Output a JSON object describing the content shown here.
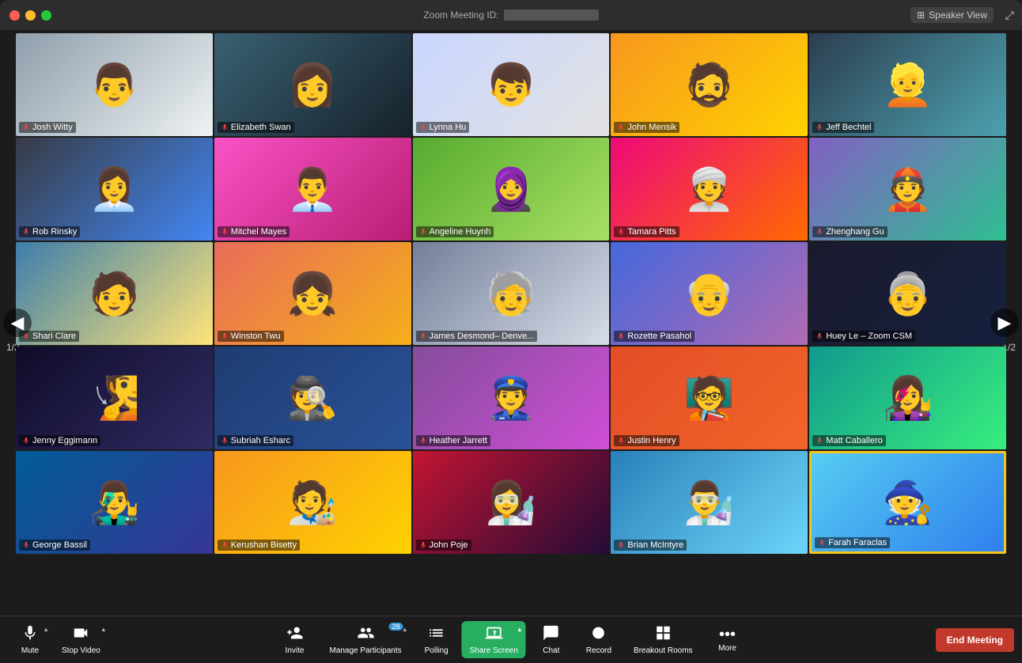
{
  "titleBar": {
    "meetingLabel": "Zoom Meeting ID:",
    "speakerView": "Speaker View"
  },
  "navigation": {
    "leftPage": "1/2",
    "rightPage": "1/2"
  },
  "participants": [
    {
      "id": 1,
      "name": "Josh Witty",
      "colorClass": "c1",
      "muted": false
    },
    {
      "id": 2,
      "name": "Elizabeth Swan",
      "colorClass": "c2",
      "muted": false
    },
    {
      "id": 3,
      "name": "Lynna Hu",
      "colorClass": "c3",
      "muted": false
    },
    {
      "id": 4,
      "name": "John Mensik",
      "colorClass": "c4",
      "muted": false
    },
    {
      "id": 5,
      "name": "Jeff Bechtel",
      "colorClass": "c5",
      "muted": false
    },
    {
      "id": 6,
      "name": "Rob Rinsky",
      "colorClass": "c6",
      "muted": false
    },
    {
      "id": 7,
      "name": "Mitchel Mayes",
      "colorClass": "c7",
      "muted": false
    },
    {
      "id": 8,
      "name": "Angeline Huynh",
      "colorClass": "c8",
      "muted": false
    },
    {
      "id": 9,
      "name": "Tamara Pitts",
      "colorClass": "c9",
      "muted": false
    },
    {
      "id": 10,
      "name": "Zhenghang Gu",
      "colorClass": "c10",
      "muted": false
    },
    {
      "id": 11,
      "name": "Shari Clare",
      "colorClass": "c11",
      "muted": false
    },
    {
      "id": 12,
      "name": "Winston Twu",
      "colorClass": "c12",
      "muted": false
    },
    {
      "id": 13,
      "name": "James Desmond– Denve...",
      "colorClass": "c13",
      "muted": false
    },
    {
      "id": 14,
      "name": "Rozette Pasahol",
      "colorClass": "c14",
      "muted": false
    },
    {
      "id": 15,
      "name": "Huey Le – Zoom CSM",
      "colorClass": "c15",
      "muted": false
    },
    {
      "id": 16,
      "name": "Jenny Eggimann",
      "colorClass": "c16",
      "muted": false
    },
    {
      "id": 17,
      "name": "Subriah Esharc",
      "colorClass": "c17",
      "muted": false
    },
    {
      "id": 18,
      "name": "Heather Jarrett",
      "colorClass": "c18",
      "muted": false
    },
    {
      "id": 19,
      "name": "Justin Henry",
      "colorClass": "c19",
      "muted": false
    },
    {
      "id": 20,
      "name": "Matt Caballero",
      "colorClass": "c20",
      "muted": false
    },
    {
      "id": 21,
      "name": "George Bassil",
      "colorClass": "c21",
      "muted": false
    },
    {
      "id": 22,
      "name": "Kerushan Bisetty",
      "colorClass": "c22",
      "muted": false
    },
    {
      "id": 23,
      "name": "John Poje",
      "colorClass": "c23",
      "muted": false
    },
    {
      "id": 24,
      "name": "Brian McIntyre",
      "colorClass": "c24",
      "muted": false
    },
    {
      "id": 25,
      "name": "Farah Faraclas",
      "colorClass": "c25",
      "muted": false,
      "highlighted": true
    }
  ],
  "toolbar": {
    "muteLabel": "Mute",
    "stopVideoLabel": "Stop Video",
    "inviteLabel": "Invite",
    "manageParticipantsLabel": "Manage Participants",
    "participantCount": "28",
    "pollingLabel": "Polling",
    "shareScreenLabel": "Share Screen",
    "chatLabel": "Chat",
    "recordLabel": "Record",
    "breakoutRoomsLabel": "Breakout Rooms",
    "moreLabel": "More",
    "endMeetingLabel": "End Meeting"
  }
}
